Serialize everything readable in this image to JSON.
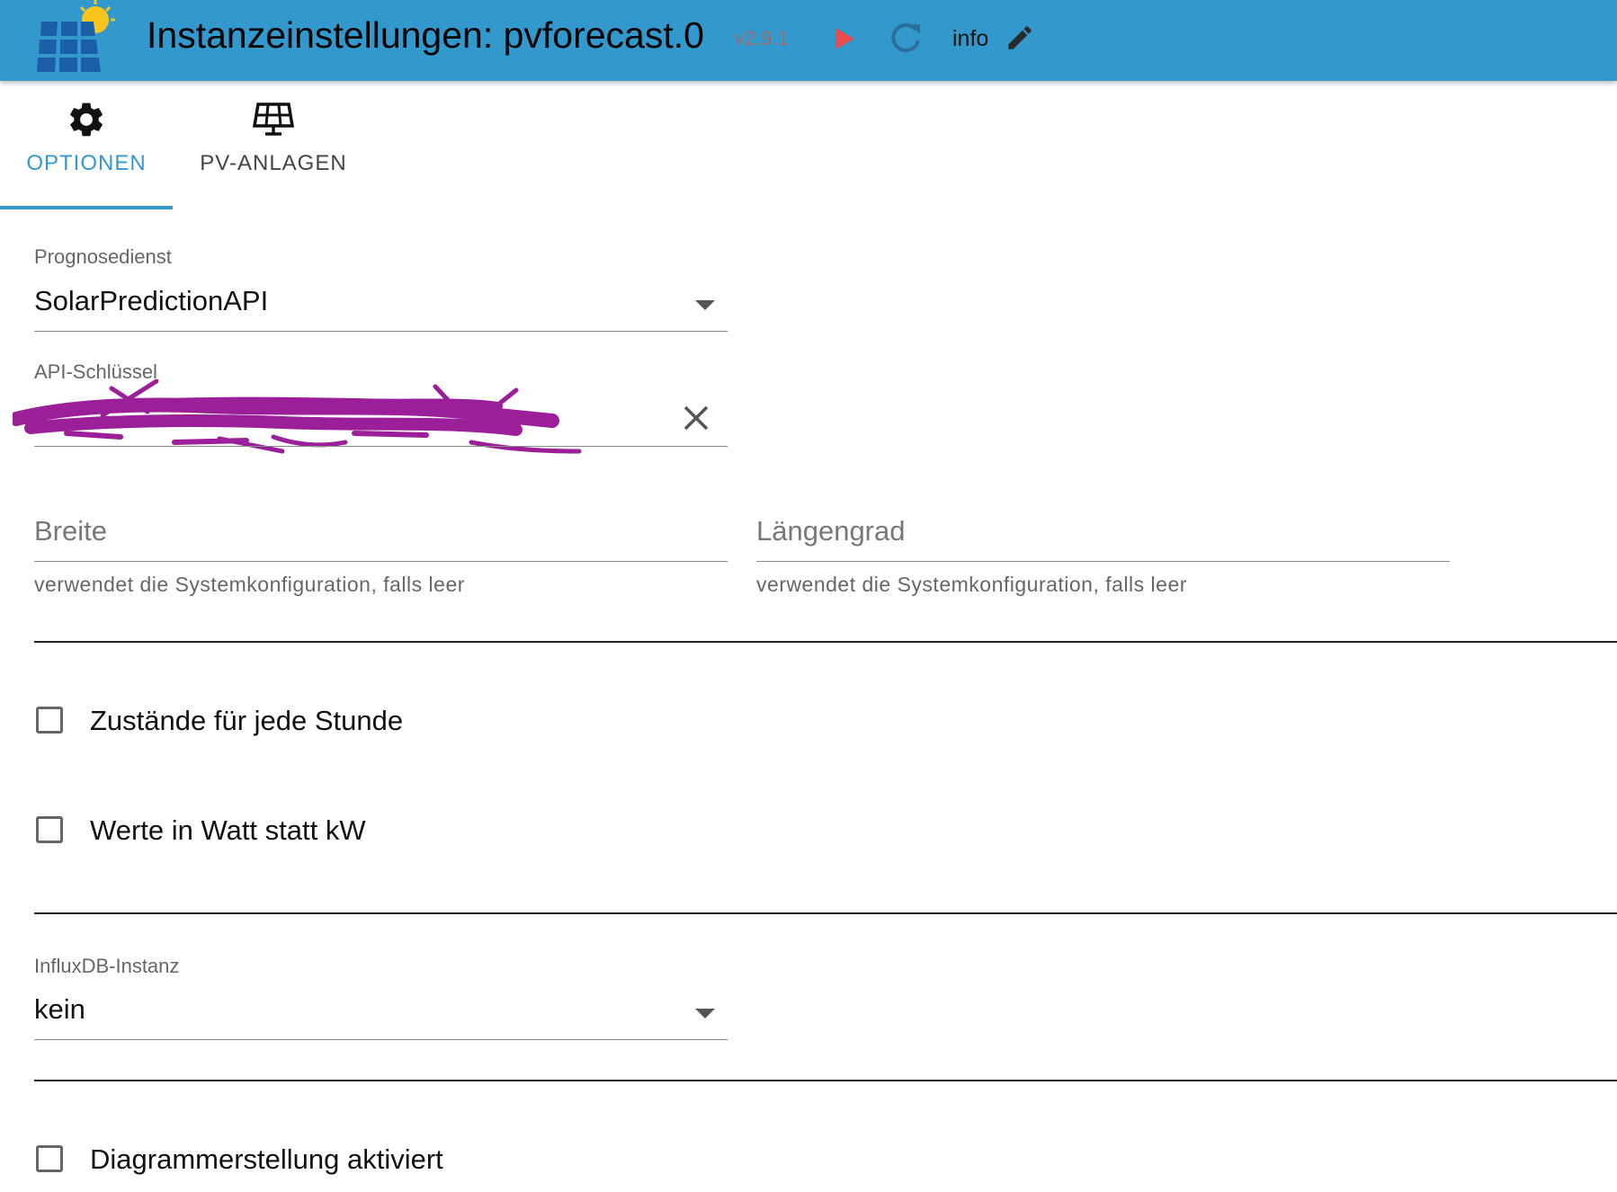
{
  "header": {
    "title": "Instanzeinstellungen: pvforecast.0",
    "version": "v2.9.1",
    "info_label": "info",
    "icons": [
      "pvforecast-logo-icon",
      "play-icon",
      "reload-icon",
      "edit-icon"
    ]
  },
  "tabs": [
    {
      "label": "OPTIONEN",
      "icon": "gear-icon",
      "active": true
    },
    {
      "label": "PV-ANLAGEN",
      "icon": "solar-panel-icon",
      "active": false
    }
  ],
  "form": {
    "forecast_service": {
      "label": "Prognosedienst",
      "value": "SolarPredictionAPI"
    },
    "api_key": {
      "label": "API-Schlüssel",
      "value": "",
      "redacted": true
    },
    "latitude": {
      "placeholder": "Breite",
      "helper": "verwendet die Systemkonfiguration, falls leer"
    },
    "longitude": {
      "placeholder": "Längengrad",
      "helper": "verwendet die Systemkonfiguration, falls leer"
    },
    "checkbox_hourly": {
      "label": "Zustände für jede Stunde",
      "checked": false
    },
    "checkbox_watts": {
      "label": "Werte in Watt statt kW",
      "checked": false
    },
    "influxdb": {
      "label": "InfluxDB-Instanz",
      "value": "kein"
    },
    "checkbox_chart": {
      "label": "Diagrammerstellung aktiviert",
      "checked": false
    }
  },
  "colors": {
    "appbar": "#3399cc",
    "accent": "#3399cc",
    "play": "#e84c4c",
    "redaction": "#9b1f98"
  }
}
